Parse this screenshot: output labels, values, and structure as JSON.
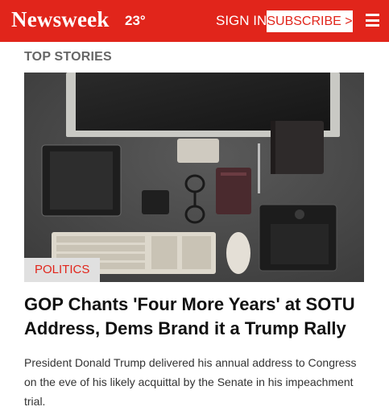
{
  "header": {
    "logo_text": "Newsweek",
    "temperature": "23°",
    "signin_label": "SIGN IN",
    "subscribe_label": "SUBSCRIBE >",
    "menu_icon": "hamburger-menu-icon",
    "brand_color": "#e1251b"
  },
  "section": {
    "title": "TOP STORIES"
  },
  "article": {
    "image_alt": "desk with monitor, tablet, keyboard, glasses and accessories",
    "category": "POLITICS",
    "headline": "GOP Chants 'Four More Years' at SOTU Address, Dems Brand it a Trump Rally",
    "summary": "President Donald Trump delivered his annual address to Congress on the eve of his likely acquittal by the Senate in his impeachment trial."
  }
}
